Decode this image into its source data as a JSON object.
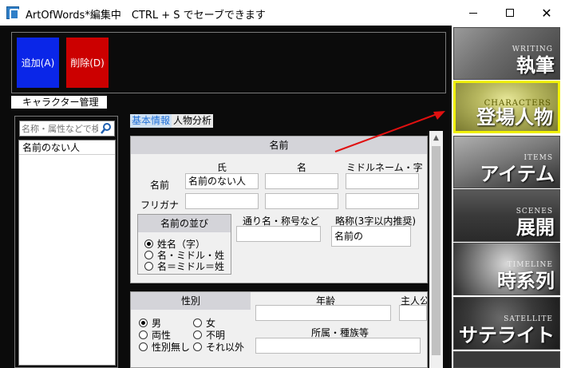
{
  "window": {
    "title": "ArtOfWords*編集中　CTRL + S でセーブできます"
  },
  "toolbar": {
    "add_label": "追加(A)",
    "delete_label": "削除(D)",
    "add_color": "#0a26e8",
    "delete_color": "#cc0000"
  },
  "left": {
    "group_label": "キャラクター管理",
    "search_placeholder": "名称・属性などで検",
    "items": [
      "名前のない人"
    ]
  },
  "tabs": [
    {
      "label": "基本情報",
      "active": true
    },
    {
      "label": "人物分析",
      "active": false
    }
  ],
  "name_section": {
    "header": "名前",
    "col_surname": "氏",
    "col_given": "名",
    "col_middle": "ミドルネーム・字",
    "row_name": "名前",
    "row_furigana": "フリガナ",
    "surname_value": "名前のない人",
    "order_title": "名前の並び",
    "order_options": [
      "姓名（字）",
      "名・ミドル・姓",
      "名＝ミドル＝姓"
    ],
    "order_selected": 0,
    "alias_label": "通り名・称号など",
    "short_label": "略称(3字以内推奨)",
    "short_value": "名前の"
  },
  "attr_section": {
    "gender_title": "性別",
    "gender_options": [
      "男",
      "女",
      "両性",
      "不明",
      "性別無し",
      "それ以外"
    ],
    "gender_selected": 0,
    "age_label": "年齢",
    "main_label": "主人公",
    "affiliation_label": "所属・種族等"
  },
  "nav": [
    {
      "en": "WRITING",
      "jp": "執筆",
      "active": false
    },
    {
      "en": "CHARACTERS",
      "jp": "登場人物",
      "active": true
    },
    {
      "en": "ITEMS",
      "jp": "アイテム",
      "active": false
    },
    {
      "en": "SCENES",
      "jp": "展開",
      "active": false
    },
    {
      "en": "TIMELINE",
      "jp": "時系列",
      "active": false
    },
    {
      "en": "SATELLITE",
      "jp": "サテライト",
      "active": false
    },
    {
      "en": "",
      "jp": "",
      "active": false
    }
  ],
  "colors": {
    "accent_tab": "#1e6fd9",
    "active_nav_border": "#f0f000"
  }
}
